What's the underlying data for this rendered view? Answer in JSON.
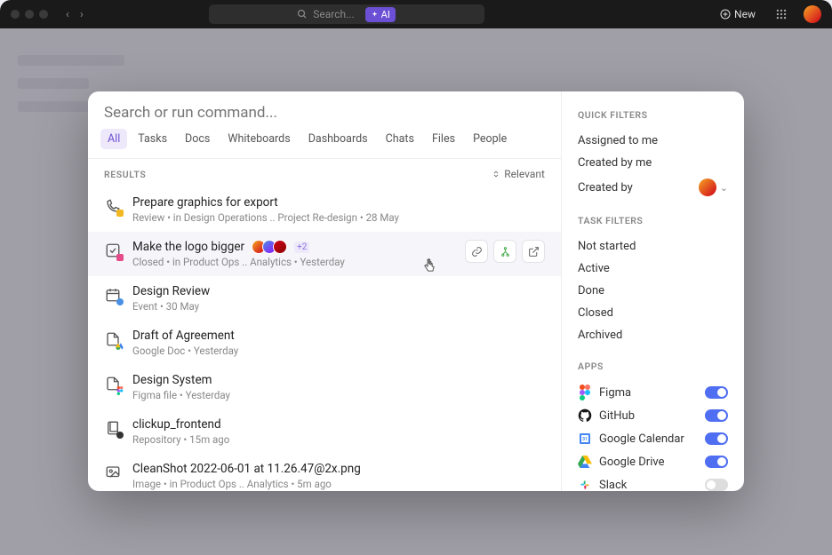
{
  "topbar": {
    "search_placeholder": "Search...",
    "ai_label": "AI",
    "new_label": "New"
  },
  "modal": {
    "search_placeholder": "Search or run command...",
    "tabs": [
      "All",
      "Tasks",
      "Docs",
      "Whiteboards",
      "Dashboards",
      "Chats",
      "Files",
      "People"
    ],
    "results_label": "RESULTS",
    "sort_label": "Relevant"
  },
  "results": [
    {
      "title": "Prepare graphics for export",
      "meta": "Review  •  in Design Operations ..   Project Re-design  •  28 May"
    },
    {
      "title": "Make the logo bigger",
      "plus": "+2",
      "meta": "Closed  •  in Product Ops ..   Analytics  •  Yesterday"
    },
    {
      "title": "Design Review",
      "meta": "Event  •  30 May"
    },
    {
      "title": "Draft of Agreement",
      "meta": "Google Doc  •  Yesterday"
    },
    {
      "title": "Design System",
      "meta": "Figma file  •  Yesterday"
    },
    {
      "title": "clickup_frontend",
      "meta": "Repository  •  15m ago"
    },
    {
      "title": "CleanShot 2022-06-01 at 11.26.47@2x.png",
      "meta": "Image  •  in Product Ops ..   Analytics  •  5m ago"
    }
  ],
  "quick_filters": {
    "label": "QUICK FILTERS",
    "items": [
      "Assigned to me",
      "Created by me",
      "Created by"
    ]
  },
  "task_filters": {
    "label": "TASK FILTERS",
    "items": [
      "Not started",
      "Active",
      "Done",
      "Closed",
      "Archived"
    ]
  },
  "apps": {
    "label": "APPS",
    "items": [
      {
        "name": "Figma",
        "on": true
      },
      {
        "name": "GitHub",
        "on": true
      },
      {
        "name": "Google Calendar",
        "on": true
      },
      {
        "name": "Google Drive",
        "on": true
      },
      {
        "name": "Slack",
        "on": false
      }
    ]
  }
}
